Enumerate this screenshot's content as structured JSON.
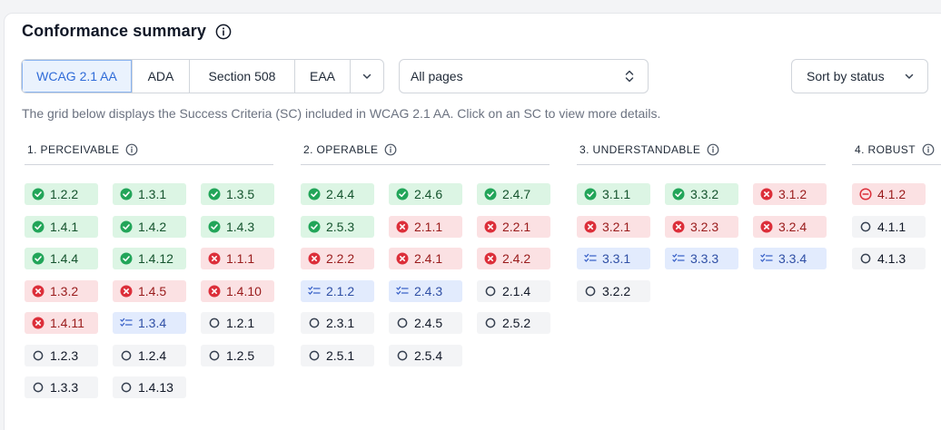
{
  "header": {
    "title": "Conformance summary",
    "info_icon": "info-icon"
  },
  "tabs": [
    {
      "label": "WCAG 2.1 AA",
      "active": true
    },
    {
      "label": "ADA",
      "active": false
    },
    {
      "label": "Section 508",
      "active": false
    },
    {
      "label": "EAA",
      "active": false
    }
  ],
  "tabs_more_icon": "chevron-down-icon",
  "pages_select": {
    "value": "All pages",
    "icon": "up-down-chevron-icon"
  },
  "sort_select": {
    "value": "Sort by status",
    "icon": "chevron-down-icon"
  },
  "description": "The grid below displays the Success Criteria (SC) included in WCAG 2.1 AA. Click on an SC to view more details.",
  "status_colors": {
    "pass": "#22a559",
    "fail": "#dc2f3a",
    "review": "#3b63c9",
    "na": "#374151",
    "partial": "#dc2f3a"
  },
  "groups": [
    {
      "heading": "1. PERCEIVABLE",
      "criteria": [
        {
          "id": "1.2.2",
          "status": "pass"
        },
        {
          "id": "1.3.1",
          "status": "pass"
        },
        {
          "id": "1.3.5",
          "status": "pass"
        },
        {
          "id": "1.4.1",
          "status": "pass"
        },
        {
          "id": "1.4.2",
          "status": "pass"
        },
        {
          "id": "1.4.3",
          "status": "pass"
        },
        {
          "id": "1.4.4",
          "status": "pass"
        },
        {
          "id": "1.4.12",
          "status": "pass"
        },
        {
          "id": "1.1.1",
          "status": "fail"
        },
        {
          "id": "1.3.2",
          "status": "fail"
        },
        {
          "id": "1.4.5",
          "status": "fail"
        },
        {
          "id": "1.4.10",
          "status": "fail"
        },
        {
          "id": "1.4.11",
          "status": "fail"
        },
        {
          "id": "1.3.4",
          "status": "review"
        },
        {
          "id": "1.2.1",
          "status": "na"
        },
        {
          "id": "1.2.3",
          "status": "na"
        },
        {
          "id": "1.2.4",
          "status": "na"
        },
        {
          "id": "1.2.5",
          "status": "na"
        },
        {
          "id": "1.3.3",
          "status": "na"
        },
        {
          "id": "1.4.13",
          "status": "na"
        }
      ]
    },
    {
      "heading": "2. OPERABLE",
      "criteria": [
        {
          "id": "2.4.4",
          "status": "pass"
        },
        {
          "id": "2.4.6",
          "status": "pass"
        },
        {
          "id": "2.4.7",
          "status": "pass"
        },
        {
          "id": "2.5.3",
          "status": "pass"
        },
        {
          "id": "2.1.1",
          "status": "fail"
        },
        {
          "id": "2.2.1",
          "status": "fail"
        },
        {
          "id": "2.2.2",
          "status": "fail"
        },
        {
          "id": "2.4.1",
          "status": "fail"
        },
        {
          "id": "2.4.2",
          "status": "fail"
        },
        {
          "id": "2.1.2",
          "status": "review"
        },
        {
          "id": "2.4.3",
          "status": "review"
        },
        {
          "id": "2.1.4",
          "status": "na"
        },
        {
          "id": "2.3.1",
          "status": "na"
        },
        {
          "id": "2.4.5",
          "status": "na"
        },
        {
          "id": "2.5.2",
          "status": "na"
        },
        {
          "id": "2.5.1",
          "status": "na"
        },
        {
          "id": "2.5.4",
          "status": "na"
        }
      ]
    },
    {
      "heading": "3. UNDERSTANDABLE",
      "criteria": [
        {
          "id": "3.1.1",
          "status": "pass"
        },
        {
          "id": "3.3.2",
          "status": "pass"
        },
        {
          "id": "3.1.2",
          "status": "fail"
        },
        {
          "id": "3.2.1",
          "status": "fail"
        },
        {
          "id": "3.2.3",
          "status": "fail"
        },
        {
          "id": "3.2.4",
          "status": "fail"
        },
        {
          "id": "3.3.1",
          "status": "review"
        },
        {
          "id": "3.3.3",
          "status": "review"
        },
        {
          "id": "3.3.4",
          "status": "review"
        },
        {
          "id": "3.2.2",
          "status": "na"
        }
      ]
    },
    {
      "heading": "4. ROBUST",
      "criteria": [
        {
          "id": "4.1.2",
          "status": "partial"
        },
        {
          "id": "4.1.1",
          "status": "na"
        },
        {
          "id": "4.1.3",
          "status": "na"
        }
      ]
    }
  ]
}
